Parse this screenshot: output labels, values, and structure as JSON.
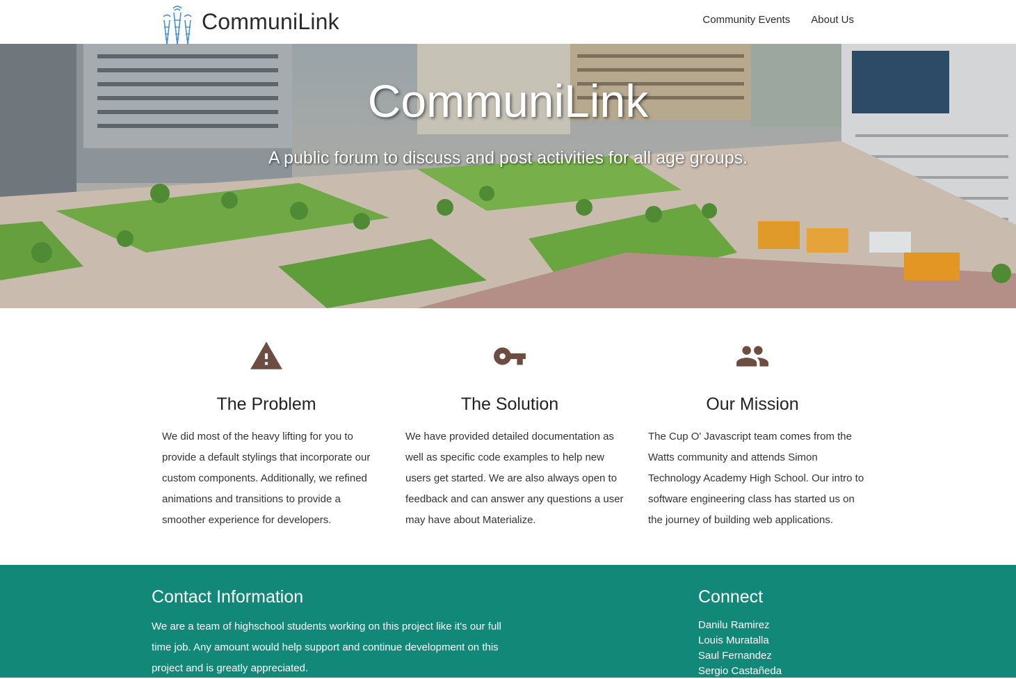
{
  "nav": {
    "brand": "CommuniLink",
    "links": [
      {
        "label": "Community Events"
      },
      {
        "label": "About Us"
      }
    ]
  },
  "hero": {
    "title": "CommuniLink",
    "subtitle": "A public forum to discuss and post activities for all age groups."
  },
  "features": [
    {
      "icon": "warning-icon",
      "title": "The Problem",
      "text": "We did most of the heavy lifting for you to provide a default stylings that incorporate our custom components. Additionally, we refined animations and transitions to provide a smoother experience for developers."
    },
    {
      "icon": "key-icon",
      "title": "The Solution",
      "text": "We have provided detailed documentation as well as specific code examples to help new users get started. We are also always open to feedback and can answer any questions a user may have about Materialize."
    },
    {
      "icon": "group-icon",
      "title": "Our Mission",
      "text": "The Cup O' Javascript team comes from the Watts community and attends Simon Technology Academy High School. Our intro to software engineering class has started us on the journey of building web applications."
    }
  ],
  "footer": {
    "contact_title": "Contact Information",
    "contact_text": "We are a team of highschool students working on this project like it's our full time job. Any amount would help support and continue development on this project and is greatly appreciated.",
    "connect_title": "Connect",
    "connect_items": [
      "Danilu Ramirez",
      "Louis Muratalla",
      "Saul Fernandez",
      "Sergio Castañeda"
    ]
  },
  "colors": {
    "icon_brown": "#6d4c41",
    "footer_teal": "#128879",
    "logo_blue": "#4a90d9"
  }
}
